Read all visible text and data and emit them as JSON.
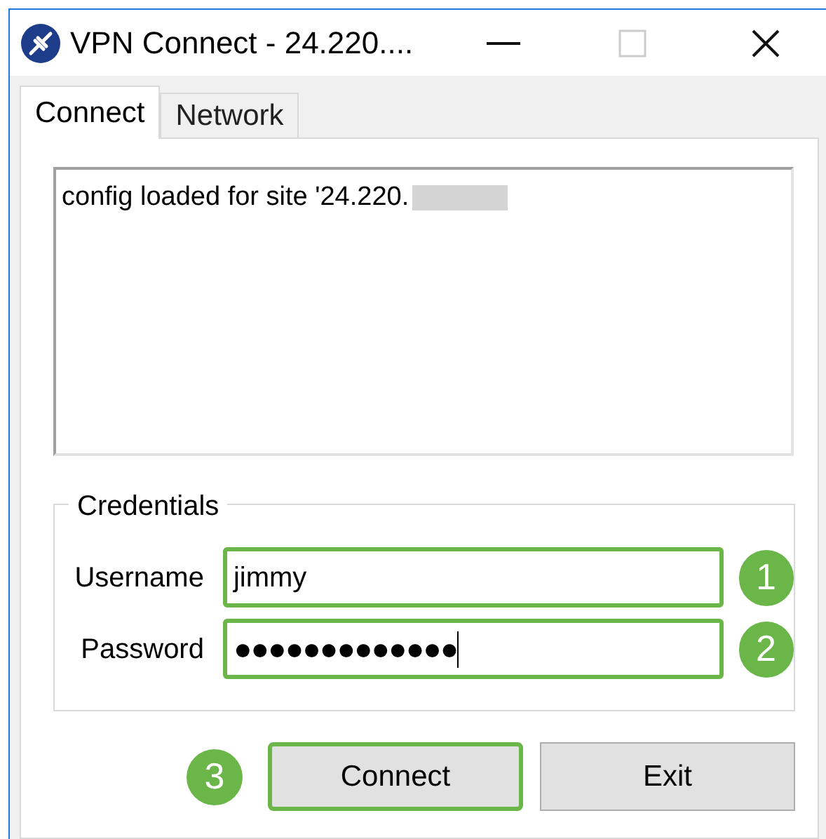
{
  "window": {
    "title": "VPN Connect - 24.220...."
  },
  "tabs": [
    {
      "label": "Connect",
      "selected": true
    },
    {
      "label": "Network",
      "selected": false
    }
  ],
  "log": {
    "lines": [
      {
        "text": "config loaded for site '24.220.",
        "redacted": true
      }
    ]
  },
  "credentials": {
    "title": "Credentials",
    "fields": [
      {
        "label": "Username",
        "value": "jimmy",
        "kind": "text",
        "highlighted": true,
        "step": "1",
        "focused": false
      },
      {
        "label": "Password",
        "value": "●●●●●●●●●●●●●",
        "kind": "password",
        "highlighted": true,
        "step": "2",
        "focused": true
      }
    ]
  },
  "buttons": [
    {
      "label": "Connect",
      "highlighted": true,
      "step": "3"
    },
    {
      "label": "Exit",
      "highlighted": false
    }
  ]
}
